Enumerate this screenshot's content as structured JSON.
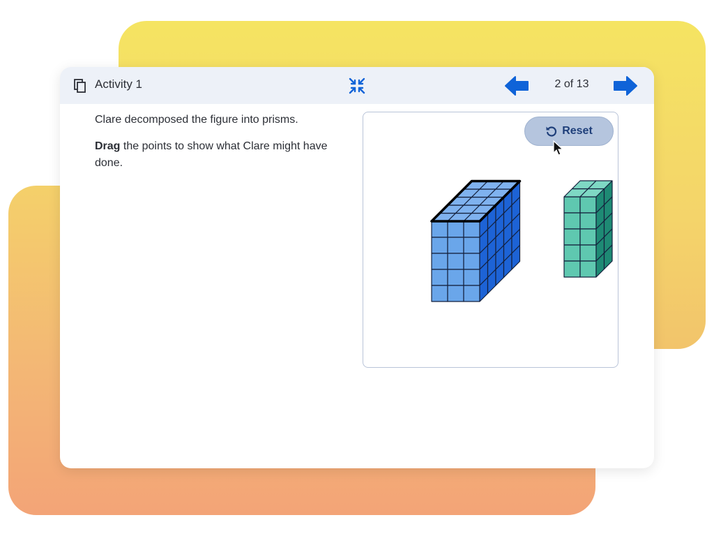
{
  "header": {
    "title": "Activity 1",
    "page_counter": "2 of 13",
    "icons": {
      "copy": "copy-icon",
      "collapse": "collapse-icon",
      "prev": "arrow-left-icon",
      "next": "arrow-right-icon"
    }
  },
  "prompt": {
    "line1": "Clare decomposed the figure into prisms.",
    "drag_bold": "Drag",
    "drag_rest": " the points to show what Clare might have done."
  },
  "canvas": {
    "reset_label": "Reset",
    "reset_icon": "undo-icon"
  },
  "colors": {
    "accent": "#0f63d8",
    "blue_front": "#6aa6ea",
    "blue_side": "#1d63d6",
    "teal_front": "#5fc8b0",
    "teal_side": "#1e8a74",
    "panel_border": "#b9c4d8",
    "reset_bg": "#b5c5de"
  }
}
